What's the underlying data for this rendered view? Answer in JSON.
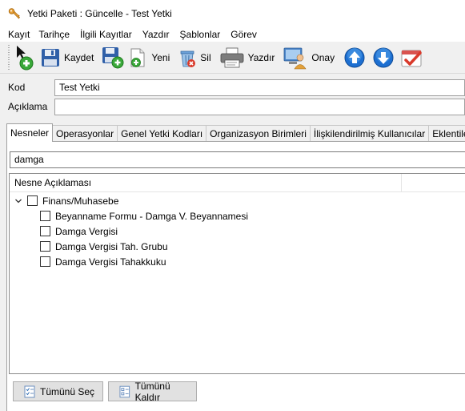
{
  "window": {
    "title": "Yetki Paketi : Güncelle - Test Yetki",
    "icon": "key-icon"
  },
  "menu": [
    {
      "label": "Kayıt"
    },
    {
      "label": "Tarihçe"
    },
    {
      "label": "İlgili Kayıtlar"
    },
    {
      "label": "Yazdır"
    },
    {
      "label": "Şablonlar"
    },
    {
      "label": "Görev"
    }
  ],
  "toolbar": {
    "new_record_icon": "cursor-add-icon",
    "save_label": "Kaydet",
    "save_new_icon": "save-add-icon",
    "new_label": "Yeni",
    "delete_label": "Sil",
    "print_label": "Yazdır",
    "approve_label": "Onay",
    "up_icon": "arrow-up-icon",
    "down_icon": "arrow-down-icon",
    "check_icon": "checklist-icon"
  },
  "form": {
    "code_label": "Kod",
    "code_value": "Test Yetki",
    "description_label": "Açıklama",
    "description_value": ""
  },
  "tabs": [
    {
      "label": "Nesneler",
      "active": true
    },
    {
      "label": "Operasyonlar"
    },
    {
      "label": "Genel Yetki Kodları"
    },
    {
      "label": "Organizasyon Birimleri"
    },
    {
      "label": "İlişkilendirilmiş Kullanıcılar"
    },
    {
      "label": "Eklentiler"
    }
  ],
  "search": {
    "value": "damga"
  },
  "tree": {
    "column_header": "Nesne Açıklaması",
    "root": {
      "label": "Finans/Muhasebe",
      "expanded": true,
      "checked": false
    },
    "children": [
      {
        "label": "Beyanname Formu - Damga V. Beyannamesi",
        "checked": false
      },
      {
        "label": "Damga Vergisi",
        "checked": false
      },
      {
        "label": "Damga Vergisi Tah. Grubu",
        "checked": false
      },
      {
        "label": "Damga Vergisi Tahakkuku",
        "checked": false
      }
    ]
  },
  "buttons": {
    "select_all_label": "Tümünü Seç",
    "deselect_all_label": "Tümünü Kaldır"
  },
  "colors": {
    "accent_blue": "#1d6fd1",
    "save_blue": "#2f5fa8",
    "add_green": "#3aa83a"
  }
}
